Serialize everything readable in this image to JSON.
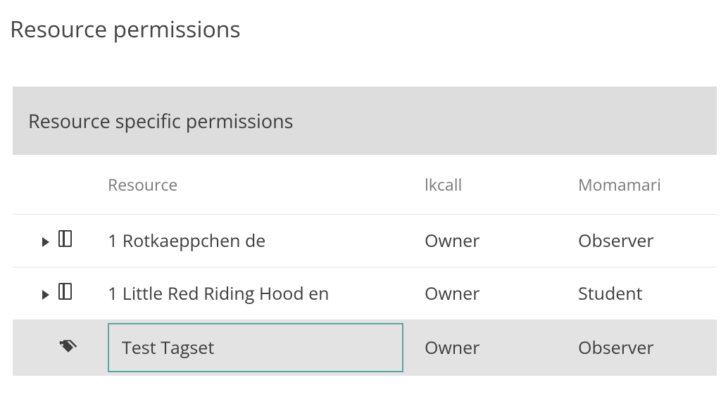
{
  "page": {
    "title": "Resource permissions"
  },
  "panel": {
    "header": "Resource specific permissions"
  },
  "table": {
    "columns": {
      "resource": "Resource",
      "user1": "lkcall",
      "user2": "Momamari"
    },
    "rows": [
      {
        "expandable": true,
        "type": "document",
        "resource": "1 Rotkaeppchen de",
        "user1": "Owner",
        "user2": "Observer",
        "selected": false
      },
      {
        "expandable": true,
        "type": "document",
        "resource": "1 Little Red Riding Hood en",
        "user1": "Owner",
        "user2": "Student",
        "selected": false
      },
      {
        "expandable": false,
        "type": "tagset",
        "resource": "Test Tagset",
        "user1": "Owner",
        "user2": "Observer",
        "selected": true
      }
    ]
  }
}
